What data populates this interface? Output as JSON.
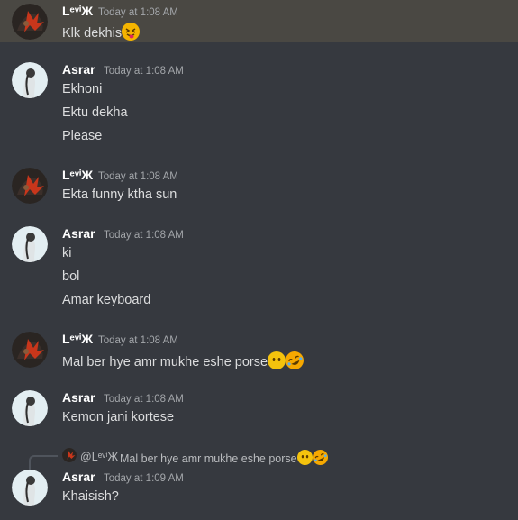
{
  "users": {
    "levix": "LᵉᵛⁱЖ",
    "asrar": "Asrar"
  },
  "messages": [
    {
      "user": "LᵉᵛⁱЖ",
      "time": "Today at 1:08 AM",
      "lines": [
        "Klk dekhis"
      ],
      "emoji": [
        "face-with-tongue"
      ]
    },
    {
      "user": "Asrar",
      "time": "Today at 1:08 AM",
      "lines": [
        "Ekhoni",
        "Ektu dekha",
        "Please"
      ]
    },
    {
      "user": "LᵉᵛⁱЖ",
      "time": "Today at 1:08 AM",
      "lines": [
        "Ekta funny ktha sun"
      ]
    },
    {
      "user": "Asrar",
      "time": "Today at 1:08 AM",
      "lines": [
        "ki",
        "bol",
        "Amar keyboard"
      ]
    },
    {
      "user": "LᵉᵛⁱЖ",
      "time": "Today at 1:08 AM",
      "lines": [
        "Mal ber hye amr mukhe eshe porse"
      ],
      "emoji": [
        "face-without-mouth",
        "rolling-on-floor-laughing"
      ]
    },
    {
      "user": "Asrar",
      "time": "Today at 1:08 AM",
      "lines": [
        "Kemon jani kortese"
      ]
    },
    {
      "user": "Asrar",
      "time": "Today at 1:09 AM",
      "lines": [
        "Khaisish?"
      ],
      "reply": {
        "user": "@LᵉᵛⁱЖ",
        "text": "Mal ber hye amr mukhe eshe porse",
        "emoji": [
          "face-without-mouth",
          "rolling-on-floor-laughing"
        ]
      }
    }
  ],
  "colors": {
    "background": "#36393f",
    "highlight": "#4a4843",
    "username": "#ffffff",
    "timestamp": "#a3a6aa",
    "text": "#dcddde"
  }
}
